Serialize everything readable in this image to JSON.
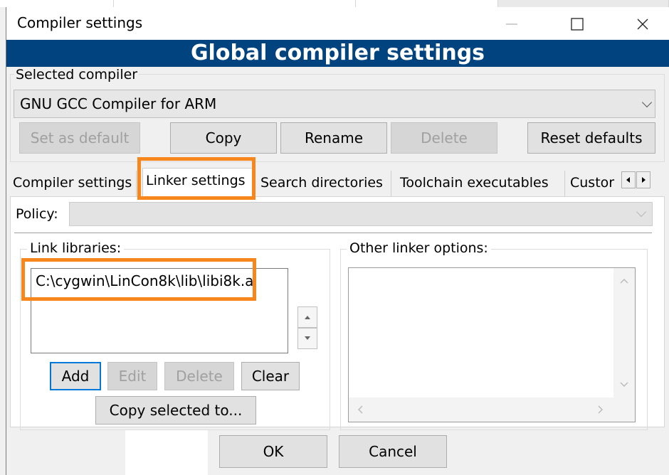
{
  "window": {
    "title": "Compiler settings",
    "banner": "Global compiler settings"
  },
  "selected_compiler": {
    "label": "Selected compiler",
    "value": "GNU GCC Compiler for ARM"
  },
  "compiler_buttons": {
    "set_default": "Set as default",
    "copy": "Copy",
    "rename": "Rename",
    "delete": "Delete",
    "reset": "Reset defaults"
  },
  "tabs": [
    {
      "label": "Compiler settings"
    },
    {
      "label": "Linker settings"
    },
    {
      "label": "Search directories"
    },
    {
      "label": "Toolchain executables"
    },
    {
      "label": "Custor"
    }
  ],
  "policy": {
    "label": "Policy:",
    "value": ""
  },
  "link_libraries": {
    "label": "Link libraries:",
    "items": [
      "C:\\cygwin\\LinCon8k\\lib\\libi8k.a"
    ],
    "buttons": {
      "add": "Add",
      "edit": "Edit",
      "delete": "Delete",
      "clear": "Clear",
      "copy_selected": "Copy selected to..."
    }
  },
  "other_linker_options": {
    "label": "Other linker options:",
    "value": ""
  },
  "footer": {
    "ok": "OK",
    "cancel": "Cancel"
  },
  "colors": {
    "banner": "#00437f",
    "highlight": "#f7861c",
    "default_button_border": "#0078d7"
  },
  "icons": [
    "minimize-icon",
    "maximize-icon",
    "close-icon",
    "chevron-down-icon",
    "arrow-left-icon",
    "arrow-right-icon",
    "arrow-up-icon",
    "arrow-down-icon"
  ]
}
